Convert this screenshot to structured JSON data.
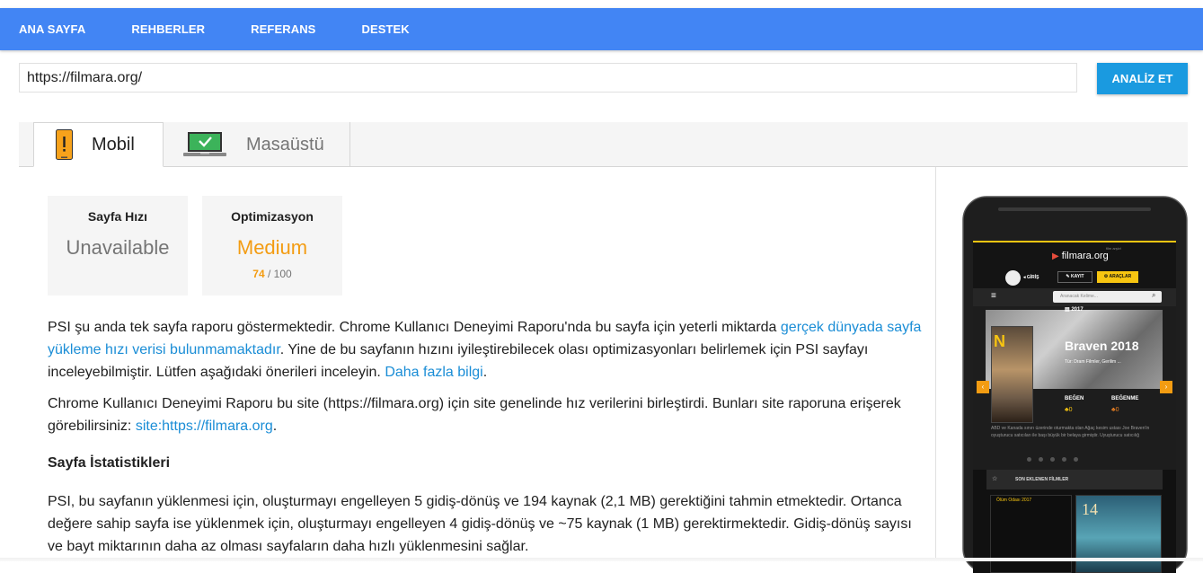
{
  "nav": {
    "items": [
      "ANA SAYFA",
      "REHBERLER",
      "REFERANS",
      "DESTEK"
    ]
  },
  "search": {
    "url_value": "https://filmara.org/",
    "analyze_label": "ANALİZ ET"
  },
  "tabs": {
    "mobile_label": "Mobil",
    "desktop_label": "Masaüstü"
  },
  "scores": {
    "speed": {
      "title": "Sayfa Hızı",
      "value": "Unavailable"
    },
    "optimization": {
      "title": "Optimizasyon",
      "value": "Medium",
      "score": "74",
      "max": "/ 100"
    }
  },
  "content": {
    "para1_a": "PSI şu anda tek sayfa raporu göstermektedir. Chrome Kullanıcı Deneyimi Raporu'nda bu sayfa için yeterli miktarda ",
    "para1_link1": "gerçek dünyada sayfa yükleme hızı verisi bulunmamaktadır",
    "para1_b": ". Yine de bu sayfanın hızını iyileştirebilecek olası optimizasyonları belirlemek için PSI sayfayı inceleyebilmiştir. Lütfen aşağıdaki önerileri inceleyin. ",
    "para1_link2": "Daha fazla bilgi",
    "para1_c": ".",
    "para2_a": "Chrome Kullanıcı Deneyimi Raporu bu site (https://filmara.org) için site genelinde hız verilerini birleştirdi. Bunları site raporuna erişerek görebilirsiniz: ",
    "para2_link": "site:https://filmara.org",
    "para2_b": ".",
    "stats_title": "Sayfa İstatistikleri",
    "para3": "PSI, bu sayfanın yüklenmesi için, oluşturmayı engelleyen 5 gidiş-dönüş ve 194 kaynak (2,1 MB) gerektiğini tahmin etmektedir. Ortanca değere sahip sayfa ise yüklenmek için, oluşturmayı engelleyen 4 gidiş-dönüş ve ~75 kaynak (1 MB) gerektirmektedir. Gidiş-dönüş sayısı ve bayt miktarının daha az olması sayfaların daha hızlı yüklenmesini sağlar."
  },
  "preview": {
    "logo": "filmara.org",
    "logo_small": "film arşivi",
    "login": "GİRİŞ",
    "register": "KAYIT",
    "tools": "ARAÇLAR",
    "search_placeholder": "Aranacak Kelime...",
    "slide_year": "2017",
    "slide_title": "Braven 2018",
    "slide_genre": "Tür: Dram Filmler, Gerilim ...",
    "like": "BEĞEN",
    "dislike": "BEĞENME",
    "like_count": "0",
    "dislike_count": "0",
    "slide_desc": "ABD ve Kanada sınırı üzerinde oturmakta olan Ağaç kesim ustası Joe Braven'in oyuşturucu satıcıları ile başı büyük bir belaya girmiştir. Uyuşturucu satıcılığ",
    "section_label": "SON EKLENEN FİLMLER",
    "card1_title": "Ölüm Odası 2017",
    "card2_number": "14"
  },
  "colors": {
    "topbar": "#4285f4",
    "button": "#1a9ae0",
    "medium": "#f39c12",
    "link": "#1a8dd6",
    "preview_accent": "#f7c511"
  }
}
